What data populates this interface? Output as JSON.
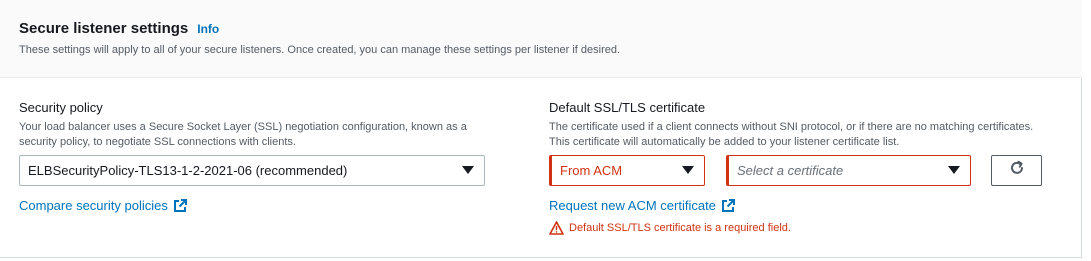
{
  "section": {
    "title": "Secure listener settings",
    "info_label": "Info",
    "description": "These settings will apply to all of your secure listeners. Once created, you can manage these settings per listener if desired."
  },
  "security_policy": {
    "label": "Security policy",
    "description": "Your load balancer uses a Secure Socket Layer (SSL) negotiation configuration, known as a security policy, to negotiate SSL connections with clients.",
    "selected": "ELBSecurityPolicy-TLS13-1-2-2021-06 (recommended)",
    "compare_link": "Compare security policies"
  },
  "certificate": {
    "label": "Default SSL/TLS certificate",
    "description": "The certificate used if a client connects without SNI protocol, or if there are no matching certificates. This certificate will automatically be added to your listener certificate list.",
    "source_selected": "From ACM",
    "cert_placeholder": "Select a certificate",
    "request_link": "Request new ACM certificate",
    "error": "Default SSL/TLS certificate is a required field."
  },
  "icons": {
    "external": "external-link-icon",
    "refresh": "refresh-icon",
    "warning": "warning-icon",
    "caret": "caret-down-icon"
  },
  "colors": {
    "link": "#0073bb",
    "error": "#d13212",
    "text": "#16191f",
    "muted": "#545b64"
  }
}
